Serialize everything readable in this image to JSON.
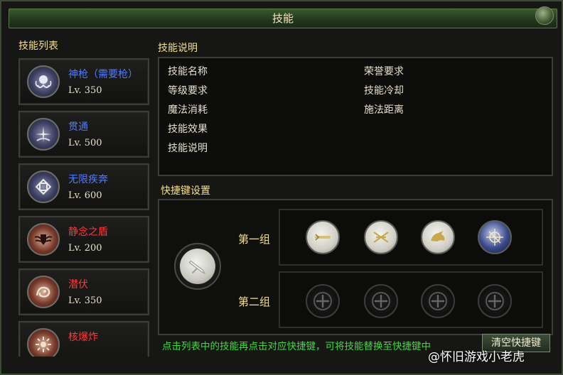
{
  "window": {
    "title": "技能"
  },
  "skill_list": {
    "title": "技能列表",
    "items": [
      {
        "name": "神枪（需要枪）",
        "level": "Lv. 350",
        "color": "#4f7bff",
        "icon": "tentacle-emblem-icon"
      },
      {
        "name": "贯通",
        "level": "Lv. 500",
        "color": "#4f7bff",
        "icon": "pierce-burst-icon"
      },
      {
        "name": "无限疾奔",
        "level": "Lv. 600",
        "color": "#4f7bff",
        "icon": "knot-pattern-icon"
      },
      {
        "name": "静念之盾",
        "level": "Lv. 200",
        "color": "#ff3a3a",
        "icon": "winged-shield-icon"
      },
      {
        "name": "潜伏",
        "level": "Lv. 350",
        "color": "#ff3a3a",
        "icon": "beast-crest-icon"
      },
      {
        "name": "核爆炸",
        "level": "",
        "color": "#ff3a3a",
        "icon": "explosion-icon"
      }
    ]
  },
  "skill_desc": {
    "title": "技能说明",
    "left_fields": [
      "技能名称",
      "等级要求",
      "魔法消耗",
      "技能效果",
      "技能说明"
    ],
    "right_fields": [
      "荣誉要求",
      "技能冷却",
      "施法距离"
    ]
  },
  "hotkey": {
    "title": "快捷键设置",
    "group1_label": "第一组",
    "group2_label": "第二组",
    "group1_slots": [
      "wand-icon",
      "crossed-blades-icon",
      "wolf-head-icon",
      "sun-compass-icon"
    ],
    "group2_slots": [
      "plus-icon",
      "plus-icon",
      "plus-icon",
      "plus-icon"
    ],
    "selected_slot_icon": "sword-icon",
    "hint": "点击列表中的技能再点击对应快捷键，可将技能替换至快捷键中",
    "clear_button": "清空快捷键"
  },
  "watermark": "@怀旧游戏小老虎"
}
